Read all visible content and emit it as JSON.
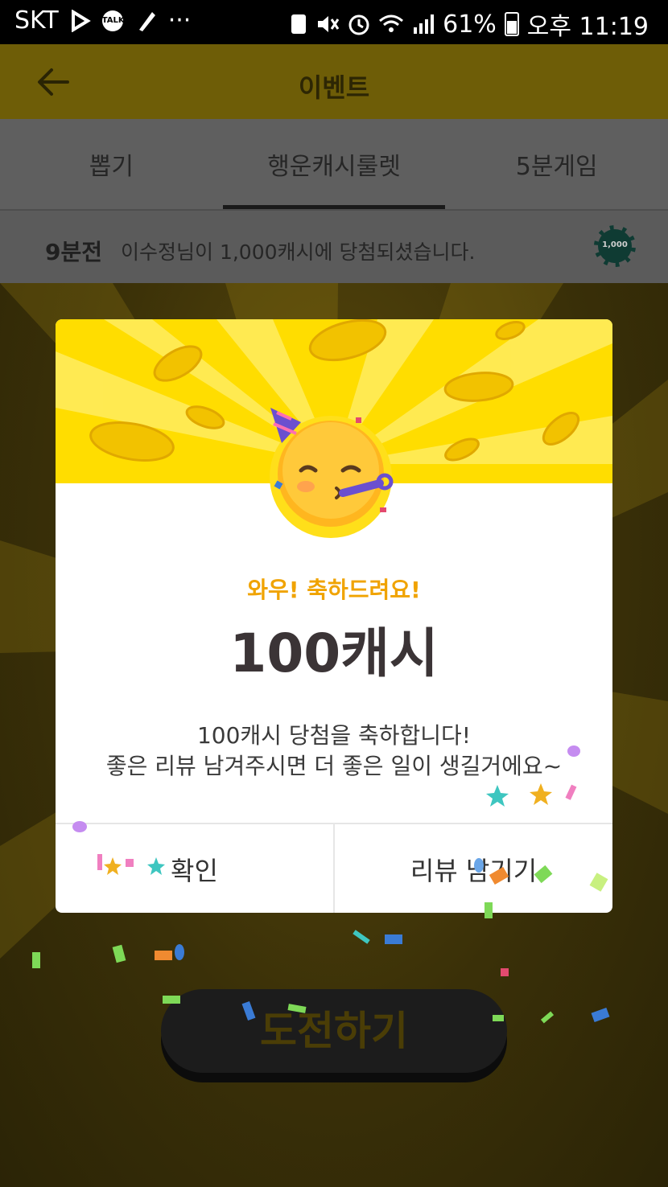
{
  "status_bar": {
    "carrier": "SKT",
    "talk_label": "TALK",
    "more": "···",
    "battery": "61%",
    "time": "오후 11:19"
  },
  "app_bar": {
    "title": "이벤트"
  },
  "tabs": [
    {
      "label": "뽑기",
      "active": false
    },
    {
      "label": "행운캐시룰렛",
      "active": true
    },
    {
      "label": "5분게임",
      "active": false
    }
  ],
  "ticker": {
    "time": "9분전",
    "text": "이수정님이 1,000캐시에 당첨되셨습니다.",
    "chip_label": "1,000"
  },
  "dialog": {
    "subtitle": "와우! 축하드려요!",
    "amount": "100캐시",
    "message_line1": "100캐시 당첨을 축하합니다!",
    "message_line2": "좋은 리뷰 남겨주시면 더 좋은 일이 생길거에요~",
    "confirm_label": "확인",
    "review_label": "리뷰 남기기"
  },
  "challenge_button": {
    "label": "도전하기"
  },
  "colors": {
    "brand_yellow": "#ffdd00",
    "subtitle_orange": "#f0a300"
  },
  "icons": [
    "back-arrow-icon",
    "partying-face-emoji",
    "cash-chip-icon"
  ]
}
